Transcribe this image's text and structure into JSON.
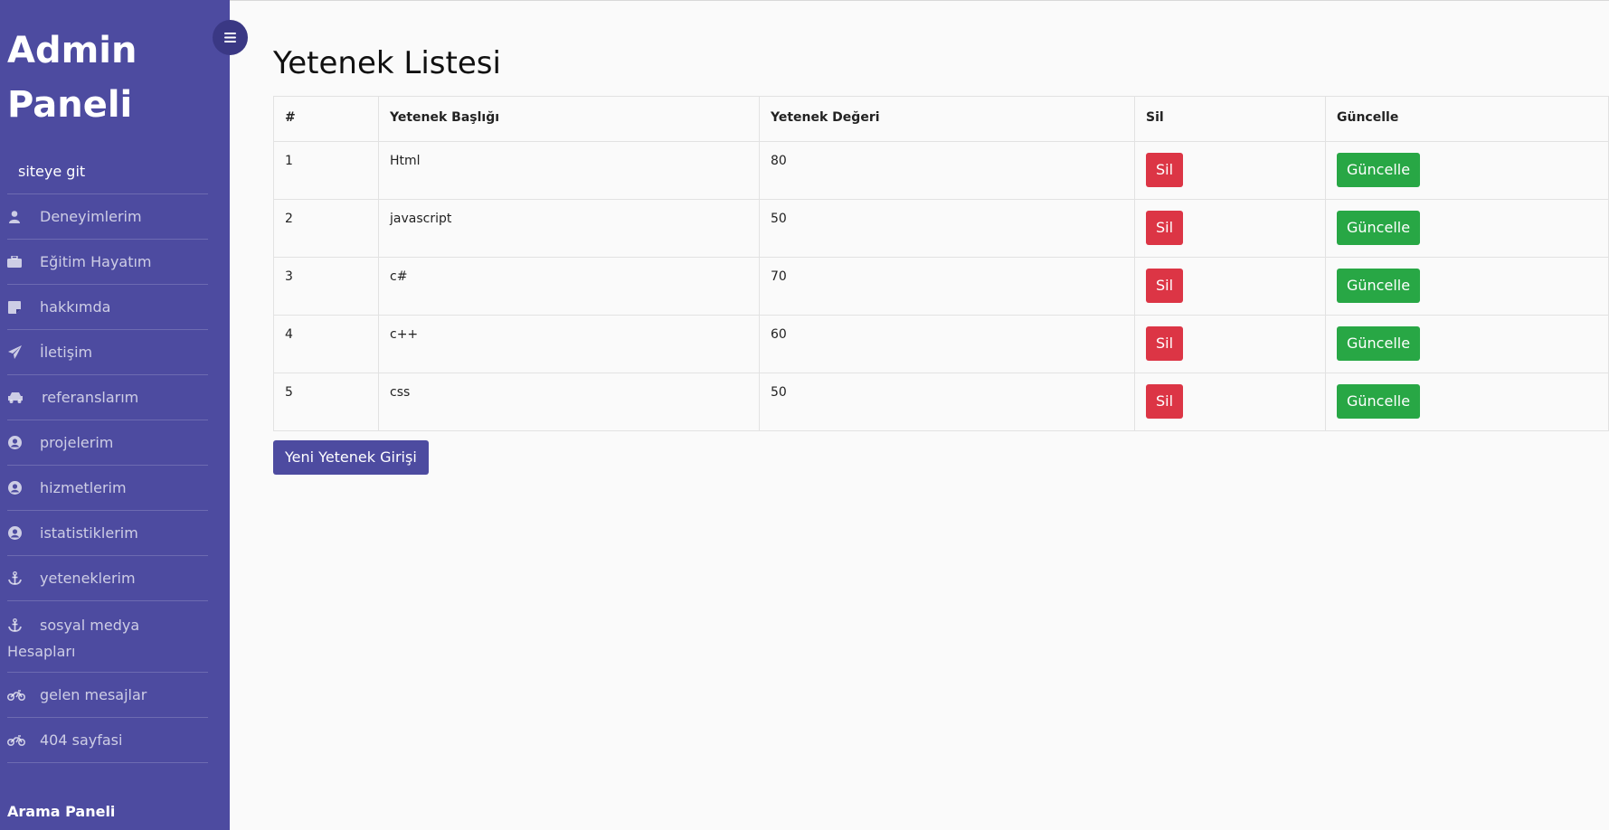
{
  "sidebar": {
    "brand": "Admin Paneli",
    "items": [
      {
        "label": "siteye git",
        "icon": ""
      },
      {
        "label": "Deneyimlerim",
        "icon": "user-icon"
      },
      {
        "label": "Eğitim Hayatım",
        "icon": "briefcase-icon"
      },
      {
        "label": "hakkımda",
        "icon": "sticky-note-icon"
      },
      {
        "label": "İletişim",
        "icon": "paper-plane-icon"
      },
      {
        "label": "referanslarım",
        "icon": "car-icon"
      },
      {
        "label": "projelerim",
        "icon": "user-circle-icon"
      },
      {
        "label": "hizmetlerim",
        "icon": "user-circle-icon"
      },
      {
        "label": "istatistiklerim",
        "icon": "user-circle-icon"
      },
      {
        "label": "yeteneklerim",
        "icon": "anchor-icon"
      },
      {
        "label": "sosyal medya Hesapları",
        "icon": "anchor-icon"
      },
      {
        "label": "gelen mesajlar",
        "icon": "motorcycle-icon"
      },
      {
        "label": "404 sayfasi",
        "icon": "motorcycle-icon"
      }
    ],
    "search_panel": "Arama Paneli"
  },
  "main": {
    "title": "Yetenek Listesi",
    "table": {
      "headers": [
        "#",
        "Yetenek Başlığı",
        "Yetenek Değeri",
        "Sil",
        "Güncelle"
      ],
      "rows": [
        {
          "id": "1",
          "title": "Html",
          "value": "80",
          "delete_label": "Sil",
          "update_label": "Güncelle"
        },
        {
          "id": "2",
          "title": "javascript",
          "value": "50",
          "delete_label": "Sil",
          "update_label": "Güncelle"
        },
        {
          "id": "3",
          "title": "c#",
          "value": "70",
          "delete_label": "Sil",
          "update_label": "Güncelle"
        },
        {
          "id": "4",
          "title": "c++",
          "value": "60",
          "delete_label": "Sil",
          "update_label": "Güncelle"
        },
        {
          "id": "5",
          "title": "css",
          "value": "50",
          "delete_label": "Sil",
          "update_label": "Güncelle"
        }
      ]
    },
    "new_button_label": "Yeni Yetenek Girişi"
  },
  "colors": {
    "sidebar_bg": "#4d4ba0",
    "danger": "#dc3545",
    "success": "#28a745",
    "primary": "#4d4ba0"
  }
}
